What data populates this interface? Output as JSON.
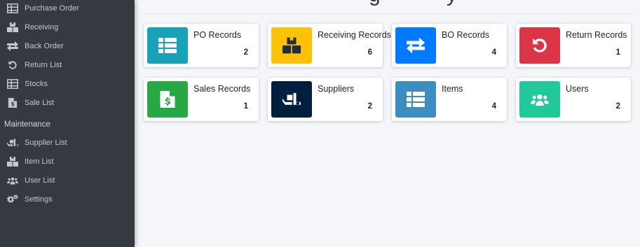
{
  "sidebar": {
    "items": [
      {
        "label": "Purchase Order",
        "icon": "table-icon"
      },
      {
        "label": "Receiving",
        "icon": "boxes-icon"
      },
      {
        "label": "Back Order",
        "icon": "exchange-icon"
      },
      {
        "label": "Return List",
        "icon": "undo-icon"
      },
      {
        "label": "Stocks",
        "icon": "table-icon"
      },
      {
        "label": "Sale List",
        "icon": "file-invoice-dollar-icon"
      }
    ],
    "maintenance_header": "Maintenance",
    "maintenance_items": [
      {
        "label": "Supplier List",
        "icon": "truck-loading-icon"
      },
      {
        "label": "Item List",
        "icon": "boxes-icon"
      },
      {
        "label": "User List",
        "icon": "users-icon"
      },
      {
        "label": "Settings",
        "icon": "cogs-icon"
      }
    ]
  },
  "header": {
    "title_fragment": "g          y"
  },
  "cards": [
    {
      "label": "PO Records",
      "count": "2",
      "color": "#17a2b8",
      "icon": "th-list-icon"
    },
    {
      "label": "Receiving Records",
      "count": "6",
      "color": "#ffc107",
      "icon": "boxes-icon"
    },
    {
      "label": "BO Records",
      "count": "4",
      "color": "#007bff",
      "icon": "exchange-icon"
    },
    {
      "label": "Return Records",
      "count": "1",
      "color": "#dc3545",
      "icon": "undo-icon"
    },
    {
      "label": "Sales Records",
      "count": "1",
      "color": "#28a745",
      "icon": "file-invoice-dollar-icon"
    },
    {
      "label": "Suppliers",
      "count": "2",
      "color": "#001f3f",
      "icon": "truck-loading-icon"
    },
    {
      "label": "Items",
      "count": "4",
      "color": "#3d8ec0",
      "icon": "th-list-icon"
    },
    {
      "label": "Users",
      "count": "2",
      "color": "#20c997",
      "icon": "users-icon"
    }
  ]
}
